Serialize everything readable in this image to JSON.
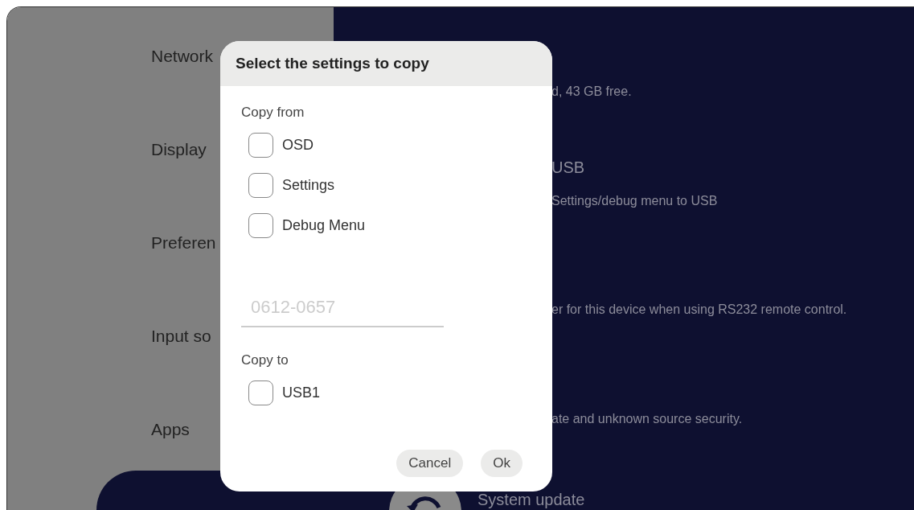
{
  "sidebar": {
    "items": [
      {
        "label": "Network"
      },
      {
        "label": "Display"
      },
      {
        "label": "Preferen"
      },
      {
        "label": "Input so"
      },
      {
        "label": "Apps"
      }
    ]
  },
  "content": {
    "storage_text": "d, 43 GB free.",
    "usb_title": "USB",
    "usb_text": "Settings/debug menu to USB",
    "rs232_text": "er for this device when using RS232 remote control.",
    "security_text": "ate and unknown source security.",
    "system_update": "System update"
  },
  "dialog": {
    "title": "Select the settings to copy",
    "copy_from": {
      "label": "Copy from",
      "options": [
        {
          "label": "OSD",
          "checked": false
        },
        {
          "label": "Settings",
          "checked": false
        },
        {
          "label": "Debug Menu",
          "checked": false
        }
      ]
    },
    "name_field": {
      "placeholder": "0612-0657"
    },
    "copy_to": {
      "label": "Copy to",
      "options": [
        {
          "label": "USB1",
          "checked": false
        }
      ]
    },
    "buttons": [
      {
        "label": "Cancel"
      },
      {
        "label": "Ok"
      }
    ]
  }
}
